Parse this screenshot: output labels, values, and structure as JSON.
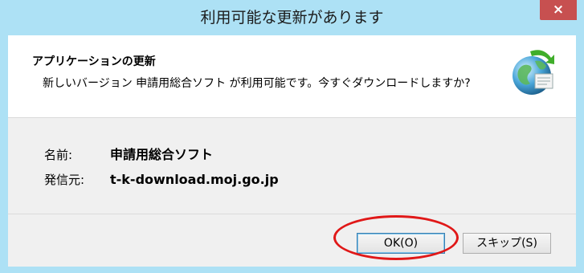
{
  "window": {
    "title": "利用可能な更新があります"
  },
  "titlebar": {
    "close_glyph": "×"
  },
  "header": {
    "title": "アプリケーションの更新",
    "description": "新しいバージョン 申請用総合ソフト が利用可能です。今すぐダウンロードしますか?",
    "icon": "globe-update-icon"
  },
  "info": {
    "name_label": "名前:",
    "name_value": "申請用総合ソフト",
    "publisher_label": "発信元:",
    "publisher_value": "t-k-download.moj.go.jp"
  },
  "buttons": {
    "ok_label": "OK(O)",
    "skip_label": "スキップ(S)"
  },
  "colors": {
    "titlebar": "#ade1f5",
    "close": "#c75050",
    "highlight": "#e01818"
  }
}
